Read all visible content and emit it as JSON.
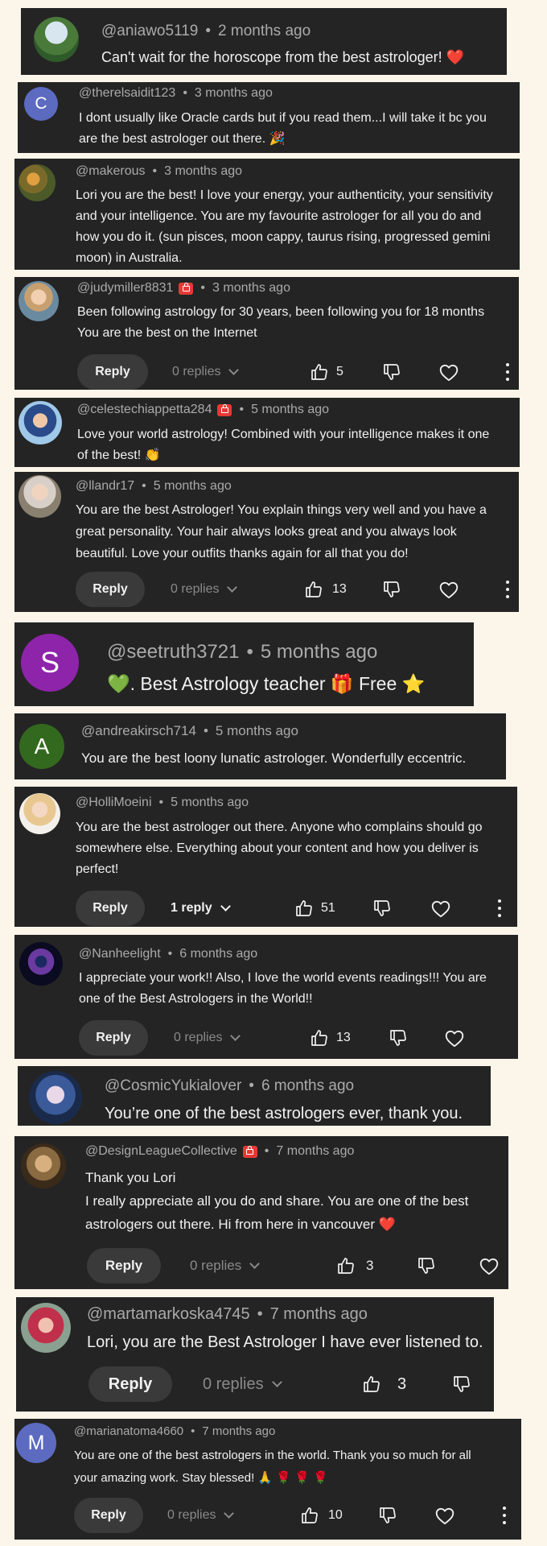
{
  "comments": [
    {
      "handle": "@aniawo5119",
      "time": "2 months ago",
      "lines": [
        "Can't wait for the horoscope from the best astrologer! ❤️"
      ]
    },
    {
      "handle": "@therelsaidit123",
      "time": "3 months ago",
      "avatar_letter": "C",
      "avatar_color": "#5c6bc0",
      "lines": [
        "I dont usually like Oracle cards but if you read them...I will take it bc you",
        "are the best astrologer out there. 🎉"
      ]
    },
    {
      "handle": "@makerous",
      "time": "3 months ago",
      "lines": [
        "Lori you are the best!  I love your energy, your authenticity, your sensitivity",
        "and your intelligence.  You are my favourite astrologer for all you do and",
        "how you do it.  (sun pisces, moon cappy, taurus rising, progressed gemini",
        "moon) in Australia."
      ]
    },
    {
      "handle": "@judymiller8831",
      "time": "3 months ago",
      "lines": [
        "Been following astrology for 30 years, been following you for 18 months",
        "You are the best on the Internet"
      ],
      "reply_label": "Reply",
      "replies_label": "0 replies",
      "likes": "5"
    },
    {
      "handle": "@celestechiappetta284",
      "time": "5 months ago",
      "lines": [
        "Love your world astrology! Combined with your intelligence makes it one",
        "of the best! 👏"
      ]
    },
    {
      "handle": "@llandr17",
      "time": "5 months ago",
      "lines": [
        "You are the best Astrologer! You explain things very well and you have a",
        "great personality. Your hair always looks great and you always look",
        "beautiful. Love your outfits thanks again for all that you do!"
      ],
      "reply_label": "Reply",
      "replies_label": "0 replies",
      "likes": "13"
    },
    {
      "handle": "@seetruth3721",
      "time": "5 months ago",
      "avatar_letter": "S",
      "avatar_color": "#8e24aa",
      "lines": [
        "💚. Best Astrology teacher 🎁 Free ⭐"
      ]
    },
    {
      "handle": "@andreakirsch714",
      "time": "5 months ago",
      "avatar_letter": "A",
      "avatar_color": "#33691e",
      "lines": [
        "You are the best loony lunatic astrologer. Wonderfully eccentric."
      ]
    },
    {
      "handle": "@HolliMoeini",
      "time": "5 months ago",
      "lines": [
        "You are the best astrologer out there.  Anyone who complains should go",
        "somewhere else.  Everything about your content and how you deliver is",
        "perfect!"
      ],
      "reply_label": "Reply",
      "replies_label": "1 reply",
      "likes": "51"
    },
    {
      "handle": "@Nanheelight",
      "time": "6 months ago",
      "lines": [
        "I appreciate your work!! Also, I love the world events readings!!! You are",
        "one of the Best Astrologers in the World!!"
      ],
      "reply_label": "Reply",
      "replies_label": "0 replies",
      "likes": "13"
    },
    {
      "handle": "@CosmicYukialover",
      "time": "6 months ago",
      "lines": [
        "You’re one of the best astrologers ever, thank you."
      ]
    },
    {
      "handle": "@DesignLeagueCollective",
      "time": "7 months ago",
      "lines": [
        "Thank you Lori",
        "I really appreciate all you do and share. You are one of the best",
        "astrologers out there. Hi from here in vancouver ❤️"
      ],
      "reply_label": "Reply",
      "replies_label": "0 replies",
      "likes": "3"
    },
    {
      "handle": "@martamarkoska4745",
      "time": "7 months ago",
      "lines": [
        "Lori, you are the Best Astrologer I have ever listened to."
      ],
      "reply_label": "Reply",
      "replies_label": "0 replies",
      "likes": "3"
    },
    {
      "handle": "@marianatoma4660",
      "time": "7 months ago",
      "avatar_letter": "M",
      "avatar_color": "#5c6bc0",
      "lines": [
        "You are one of the best astrologers in the world. Thank you so much for all",
        "your amazing work. Stay blessed! 🙏 🌹 🌹 🌹"
      ],
      "reply_label": "Reply",
      "replies_label": "0 replies",
      "likes": "10"
    }
  ],
  "colors": {
    "card_bg": "#242424",
    "page_bg": "#fbf6e9",
    "creator_badge": "#e53935",
    "heart_emoji": "#e53935"
  },
  "icons": [
    "creator-badge-icon",
    "thumbs-up-icon",
    "thumbs-down-icon",
    "heart-icon",
    "more-vert-icon",
    "chevron-down-icon"
  ]
}
